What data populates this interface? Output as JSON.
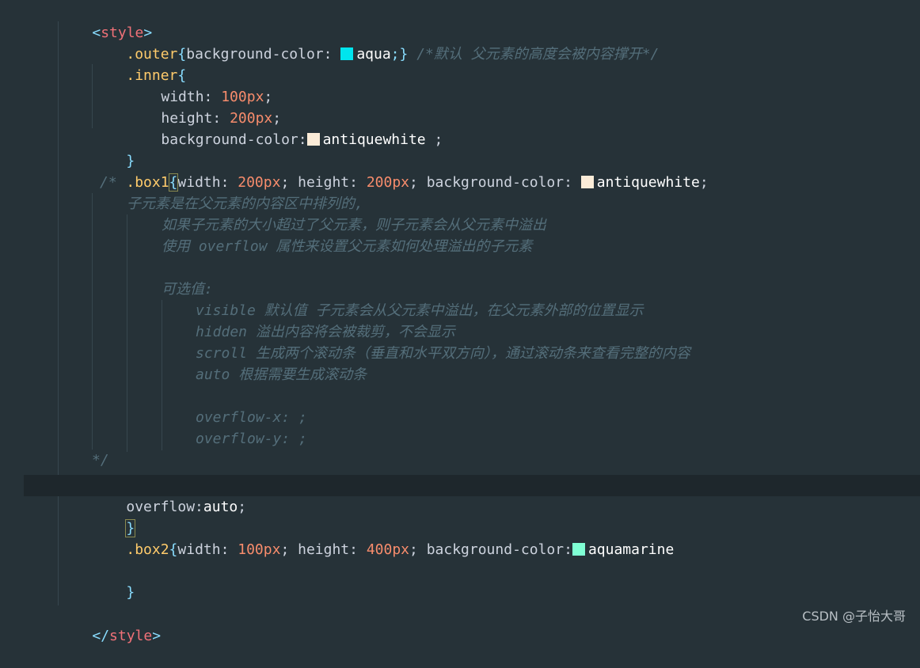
{
  "lines": {
    "l1": {
      "open": "<",
      "tag": "style",
      "close": ">"
    },
    "l2": {
      "sel": ".outer",
      "brace": "{",
      "prop": "background-color: ",
      "color_hex": "#00e5ee",
      "val": "aqua",
      "end": ";}",
      "comment": " /*默认 父元素的高度会被内容撑开*/"
    },
    "l3": {
      "sel": ".inner",
      "brace": "{"
    },
    "l4": {
      "prop": "width: ",
      "num": "100px",
      "end": ";"
    },
    "l5": {
      "prop": "height: ",
      "num": "200px",
      "end": ";"
    },
    "l6": {
      "prop": "background-color:",
      "color_hex": "#faebd7",
      "val": "antiquewhite",
      "end": " ;"
    },
    "l7": {
      "brace": "}"
    },
    "l8": {
      "sel": ".box1",
      "brace": "{",
      "p1": "width: ",
      "n1": "200px",
      "s1": "; ",
      "p2": "height: ",
      "n2": "200px",
      "s2": "; ",
      "p3": "background-color: ",
      "color_hex": "#faebd7",
      "val": "antiquewhite",
      "end": ";"
    },
    "l9": {
      "c": "/*"
    },
    "l10": {
      "c": "子元素是在父元素的内容区中排列的,"
    },
    "l11": {
      "c": "如果子元素的大小超过了父元素，则子元素会从父元素中溢出"
    },
    "l12": {
      "c": "使用 overflow 属性来设置父元素如何处理溢出的子元素"
    },
    "l13": {
      "c": ""
    },
    "l14": {
      "c": "可选值:"
    },
    "l15": {
      "c": "visible 默认值 子元素会从父元素中溢出，在父元素外部的位置显示"
    },
    "l16": {
      "c": "hidden 溢出内容将会被裁剪，不会显示"
    },
    "l17": {
      "c": "scroll 生成两个滚动条（垂直和水平双方向），通过滚动条来查看完整的内容"
    },
    "l18": {
      "c": "auto 根据需要生成滚动条"
    },
    "l19": {
      "c": ""
    },
    "l20": {
      "c": "overflow-x: ;"
    },
    "l21": {
      "c": "overflow-y: ;"
    },
    "l22": {
      "c": "*/"
    },
    "l23": {
      "prop": "overflow:",
      "val": "auto",
      "end": ";"
    },
    "l24": {
      "brace": "}"
    },
    "l25": {
      "sel": ".box2",
      "brace": "{",
      "p1": "width: ",
      "n1": "100px",
      "s1": "; ",
      "p2": "height: ",
      "n2": "400px",
      "s2": "; ",
      "p3": "background-color:",
      "color_hex": "#7fffd4",
      "val": "aquamarine"
    },
    "l26": {
      "c": ""
    },
    "l27": {
      "brace": "}"
    },
    "l28": {
      "c": ""
    },
    "l29": {
      "open": "</",
      "tag": "style",
      "close": ">"
    }
  },
  "watermark": "CSDN @子怡大哥",
  "colors": {
    "background": "#263238",
    "active_line": "#1e272c",
    "tag": "#f07178",
    "selector": "#ffcb6b",
    "number": "#f78c6c",
    "comment": "#546e7a"
  }
}
